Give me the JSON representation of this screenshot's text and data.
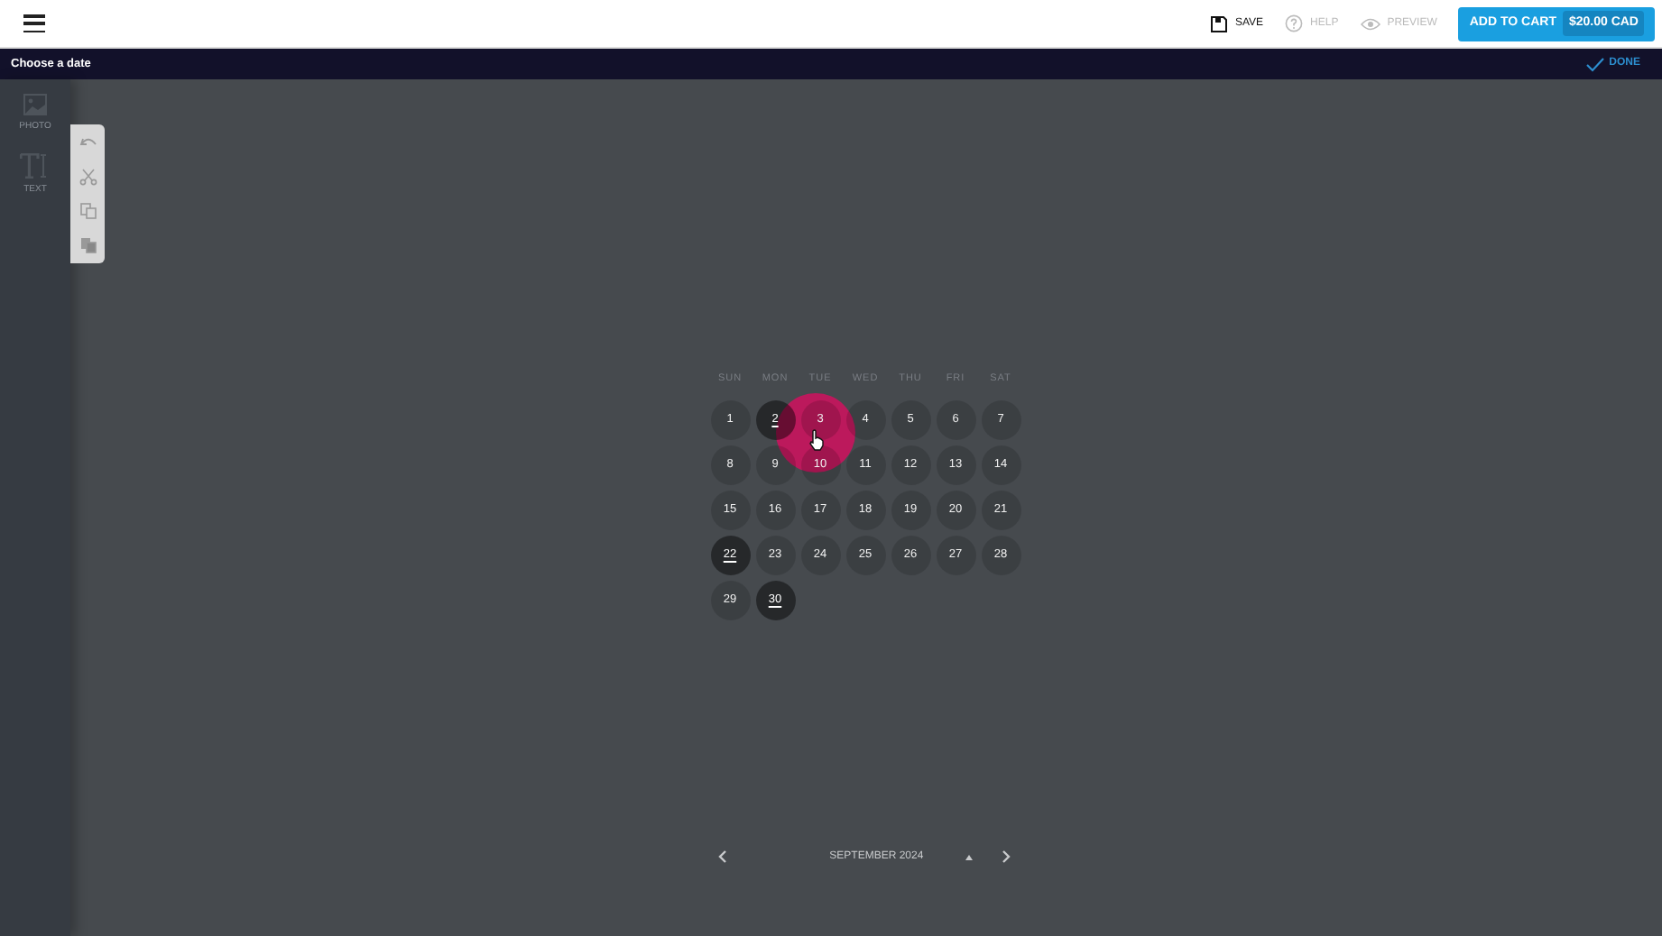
{
  "top_bar": {
    "actions": [
      {
        "kind": "save",
        "label": "SAVE",
        "disabled": false
      },
      {
        "kind": "help",
        "label": "HELP",
        "disabled": true
      },
      {
        "kind": "preview",
        "label": "PREVIEW",
        "disabled": true
      }
    ],
    "cart_button": {
      "label": "ADD TO CART",
      "price": "$20.00 CAD"
    }
  },
  "title_bar": {
    "title": "Choose a date",
    "done": "DONE"
  },
  "sidebar": {
    "items": [
      {
        "kind": "photo",
        "label": "PHOTO"
      },
      {
        "kind": "text",
        "label": "TEXT"
      }
    ]
  },
  "tools": [
    {
      "kind": "undo"
    },
    {
      "kind": "cut"
    },
    {
      "kind": "copy"
    },
    {
      "kind": "paste"
    }
  ],
  "calendar": {
    "weekdays": [
      "SUN",
      "MON",
      "TUE",
      "WED",
      "THU",
      "FRI",
      "SAT"
    ],
    "days": [
      {
        "label": "1",
        "marked": false
      },
      {
        "label": "2",
        "marked": true
      },
      {
        "label": "3",
        "marked": false
      },
      {
        "label": "4",
        "marked": false
      },
      {
        "label": "5",
        "marked": false
      },
      {
        "label": "6",
        "marked": false
      },
      {
        "label": "7",
        "marked": false
      },
      {
        "label": "8",
        "marked": false
      },
      {
        "label": "9",
        "marked": false
      },
      {
        "label": "10",
        "marked": false
      },
      {
        "label": "11",
        "marked": false
      },
      {
        "label": "12",
        "marked": false
      },
      {
        "label": "13",
        "marked": false
      },
      {
        "label": "14",
        "marked": false
      },
      {
        "label": "15",
        "marked": false
      },
      {
        "label": "16",
        "marked": false
      },
      {
        "label": "17",
        "marked": false
      },
      {
        "label": "18",
        "marked": false
      },
      {
        "label": "19",
        "marked": false
      },
      {
        "label": "20",
        "marked": false
      },
      {
        "label": "21",
        "marked": false
      },
      {
        "label": "22",
        "marked": true
      },
      {
        "label": "23",
        "marked": false
      },
      {
        "label": "24",
        "marked": false
      },
      {
        "label": "25",
        "marked": false
      },
      {
        "label": "26",
        "marked": false
      },
      {
        "label": "27",
        "marked": false
      },
      {
        "label": "28",
        "marked": false
      },
      {
        "label": "29",
        "marked": false
      },
      {
        "label": "30",
        "marked": true
      }
    ],
    "month": "SEPTEMBER 2024"
  }
}
